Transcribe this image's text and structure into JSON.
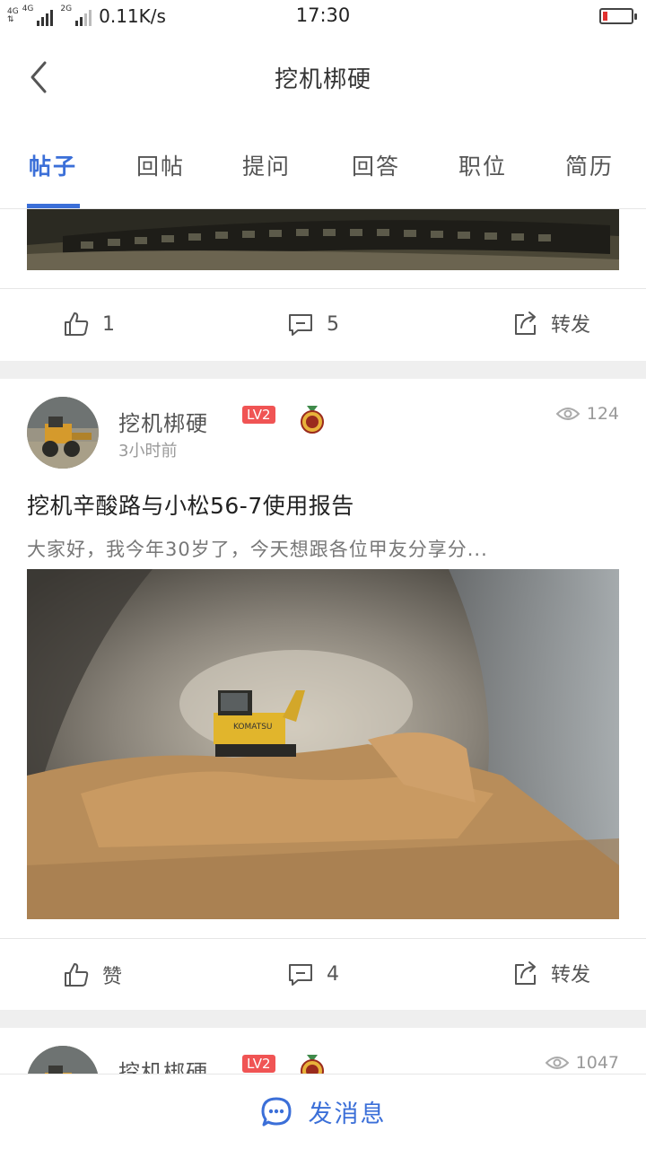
{
  "status": {
    "network_left": "4G",
    "network_mid": "4G",
    "network_right": "2G",
    "speed": "0.11K/s",
    "time": "17:30"
  },
  "header": {
    "title": "挖机梆硬"
  },
  "tabs": [
    {
      "label": "帖子"
    },
    {
      "label": "回帖"
    },
    {
      "label": "提问"
    },
    {
      "label": "回答"
    },
    {
      "label": "职位"
    },
    {
      "label": "简历"
    }
  ],
  "post0": {
    "likes": "1",
    "comments": "5",
    "share": "转发"
  },
  "post1": {
    "author": "挖机梆硬",
    "level": "LV2",
    "time": "3小时前",
    "views": "124",
    "title": "挖机辛酸路与小松56-7使用报告",
    "excerpt": "大家好，我今年30岁了，今天想跟各位甲友分享分...",
    "likes": "赞",
    "comments": "4",
    "share": "转发"
  },
  "post2": {
    "author": "挖机梆硬",
    "level": "LV2",
    "views": "1047"
  },
  "bottom": {
    "send_label": "发消息"
  },
  "colors": {
    "accent": "#3b6fd8",
    "level_badge": "#f05454",
    "battery_low": "#e0312f"
  }
}
